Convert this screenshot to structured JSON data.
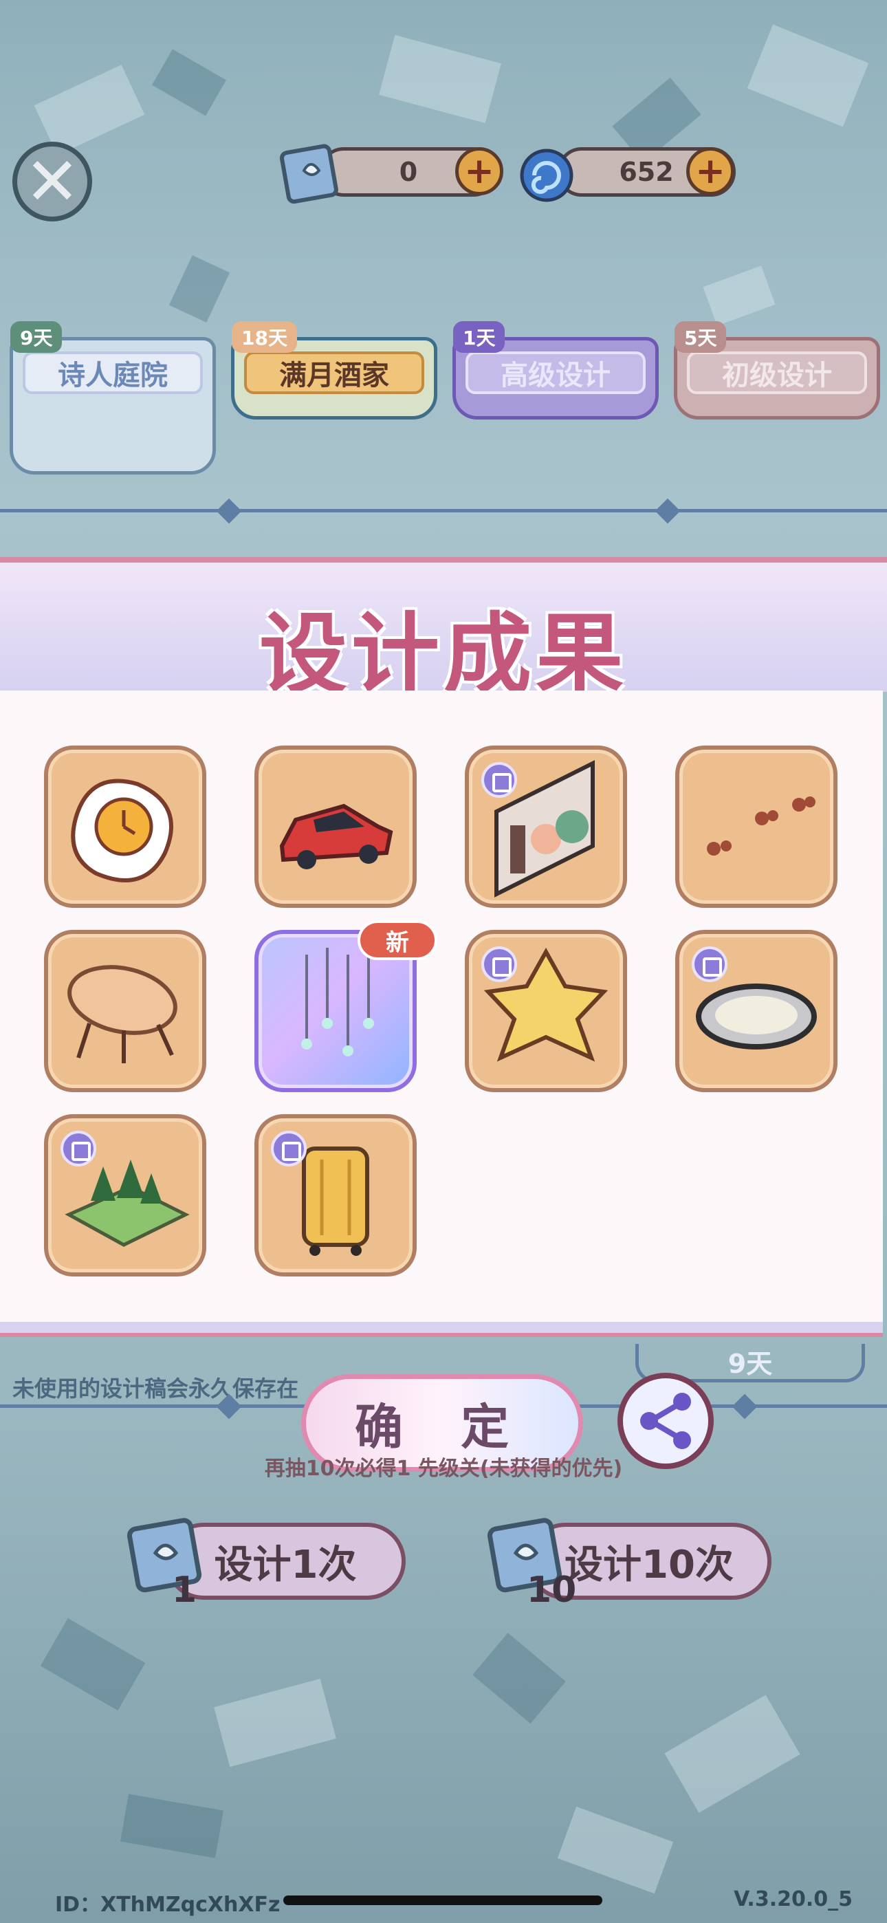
{
  "topbar": {
    "close_icon": "close-x-icon",
    "currency1": {
      "icon": "design-scroll-icon",
      "value": "0"
    },
    "currency2": {
      "icon": "swirl-orb-icon",
      "value": "652"
    }
  },
  "tabs": [
    {
      "label": "诗人庭院",
      "days": "9天"
    },
    {
      "label": "满月酒家",
      "days": "18天"
    },
    {
      "label": "高级设计",
      "days": "1天"
    },
    {
      "label": "初级设计",
      "days": "5天"
    }
  ],
  "modal": {
    "title": "设计成果",
    "new_badge": "新",
    "items": [
      {
        "name": "fried-egg-clock-icon"
      },
      {
        "name": "red-sports-car-icon"
      },
      {
        "name": "perfume-shelf-icon"
      },
      {
        "name": "paw-prints-icon"
      },
      {
        "name": "wooden-table-icon"
      },
      {
        "name": "crystal-chimes-icon"
      },
      {
        "name": "gold-star-icon"
      },
      {
        "name": "round-mirror-icon"
      },
      {
        "name": "forest-diorama-icon"
      },
      {
        "name": "yellow-suitcase-icon"
      }
    ]
  },
  "bottom": {
    "save_note": "未使用的设计稿会永久保存在",
    "timer": "9天",
    "confirm_label": "确 定",
    "hint": "再抽10次必得1 先级关(未获得的优先)",
    "design_once": {
      "label": "设计1次",
      "cost": "1"
    },
    "design_ten": {
      "label": "设计10次",
      "cost": "10"
    }
  },
  "footer": {
    "id": "ID：XThMZqcXhXFz",
    "version": "V.3.20.0_5"
  },
  "colors": {
    "accent_pink": "#c4577c",
    "frame_brown": "#b07e63",
    "item_bg": "#eebf8e",
    "line_blue": "#5e7fa3"
  }
}
